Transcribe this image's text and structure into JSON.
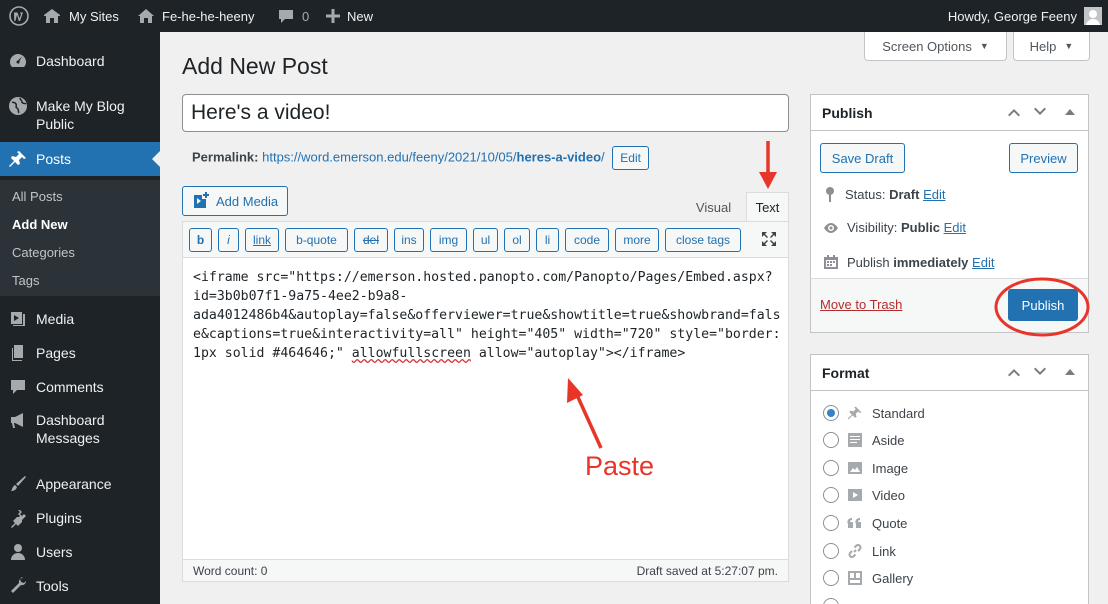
{
  "adminbar": {
    "my_sites": "My Sites",
    "site_name": "Fe-he-he-heeny",
    "comments_count": "0",
    "new_label": "New",
    "howdy": "Howdy, George Feeny"
  },
  "sidebar": {
    "items": [
      {
        "label": "Dashboard",
        "icon": "dashboard-icon"
      },
      {
        "label": "Make My Blog Public",
        "icon": "globe-icon"
      },
      {
        "label": "Posts",
        "icon": "pushpin-icon"
      },
      {
        "label": "Media",
        "icon": "media-icon"
      },
      {
        "label": "Pages",
        "icon": "pages-icon"
      },
      {
        "label": "Comments",
        "icon": "comment-icon"
      },
      {
        "label": "Dashboard Messages",
        "icon": "megaphone-icon"
      },
      {
        "label": "Appearance",
        "icon": "brush-icon"
      },
      {
        "label": "Plugins",
        "icon": "plugin-icon"
      },
      {
        "label": "Users",
        "icon": "users-icon"
      },
      {
        "label": "Tools",
        "icon": "wrench-icon"
      }
    ],
    "submenu": [
      "All Posts",
      "Add New",
      "Categories",
      "Tags"
    ]
  },
  "header": {
    "screen_options": "Screen Options",
    "help": "Help",
    "page_title": "Add New Post"
  },
  "post": {
    "title": "Here's a video!",
    "permalink_label": "Permalink:",
    "permalink_base": "https://word.emerson.edu/feeny/2021/10/05/",
    "permalink_slug": "heres-a-video",
    "permalink_trail": "/",
    "edit_label": "Edit"
  },
  "editor": {
    "add_media": "Add Media",
    "tab_visual": "Visual",
    "tab_text": "Text",
    "quicktags": [
      "b",
      "i",
      "link",
      "b-quote",
      "del",
      "ins",
      "img",
      "ul",
      "ol",
      "li",
      "code",
      "more",
      "close tags"
    ],
    "content_lines": [
      "<iframe src=\"https://emerson.hosted.panopto.com/Panopto/Pages/Embed.aspx?",
      "id=3b0b07f1-9a75-4ee2-b9a8-",
      "ada4012486b4&autoplay=false&offerviewer=true&showtitle=true&showbrand=fals",
      "e&captions=true&interactivity=all\" height=\"405\" width=\"720\" style=\"border:",
      "1px solid #464646;\" "
    ],
    "content_tail_word": "allowfullscreen",
    "content_tail_rest": " allow=\"autoplay\"></iframe>",
    "word_count": "Word count: 0",
    "draft_saved": "Draft saved at 5:27:07 pm."
  },
  "publish": {
    "title": "Publish",
    "save_draft": "Save Draft",
    "preview": "Preview",
    "status_label": "Status:",
    "status_value": "Draft",
    "visibility_label": "Visibility:",
    "visibility_value": "Public",
    "schedule_label": "Publish",
    "schedule_value": "immediately",
    "edit": "Edit",
    "move_to_trash": "Move to Trash",
    "publish_button": "Publish"
  },
  "format": {
    "title": "Format",
    "options": [
      {
        "label": "Standard",
        "icon": "pushpin-icon",
        "selected": true
      },
      {
        "label": "Aside",
        "icon": "aside-icon",
        "selected": false
      },
      {
        "label": "Image",
        "icon": "image-icon",
        "selected": false
      },
      {
        "label": "Video",
        "icon": "video-icon",
        "selected": false
      },
      {
        "label": "Quote",
        "icon": "quote-icon",
        "selected": false
      },
      {
        "label": "Link",
        "icon": "link-icon",
        "selected": false
      },
      {
        "label": "Gallery",
        "icon": "gallery-icon",
        "selected": false
      }
    ]
  },
  "annotations": {
    "paste": "Paste"
  },
  "colors": {
    "admin_dark": "#1d2327",
    "primary_blue": "#2271b1",
    "annotation_red": "#e8352a"
  }
}
